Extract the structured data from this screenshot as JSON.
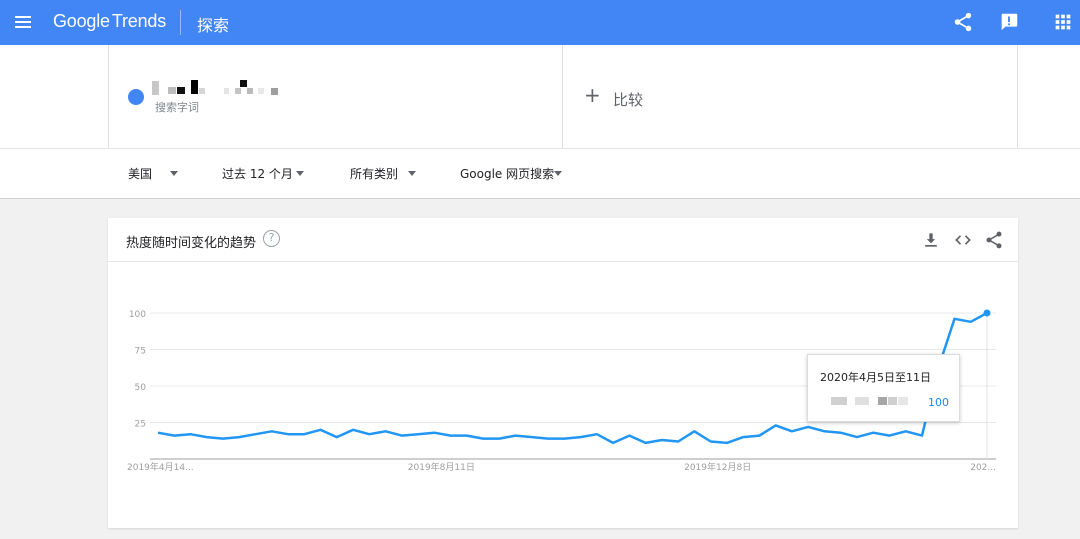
{
  "app": {
    "logo_google": "Google",
    "logo_trends": "Trends",
    "page_title": "探索"
  },
  "header_icons": [
    "share-icon",
    "feedback-icon",
    "apps-icon"
  ],
  "search": {
    "term_label": "搜索字词",
    "compare_label": "比较"
  },
  "filters": [
    {
      "label": "美国"
    },
    {
      "label": "过去 12 个月"
    },
    {
      "label": "所有类别"
    },
    {
      "label": "Google 网页搜索"
    }
  ],
  "card": {
    "title": "热度随时间变化的趋势",
    "help_glyph": "?"
  },
  "card_icons": [
    "download-icon",
    "embed-code-icon",
    "share-icon"
  ],
  "colors": {
    "header_blue": "#4285f4",
    "series_blue": "#2196f3",
    "tooltip_value": "#1e88e5"
  },
  "tooltip": {
    "date": "2020年4月5日至11日",
    "value": "100"
  },
  "chart_data": {
    "type": "line",
    "title": "",
    "ylim": [
      0,
      100
    ],
    "y_ticks": [
      25,
      50,
      75,
      100
    ],
    "x_tick_labels": [
      "2019年4月14...",
      "2019年8月11日",
      "2019年12月8日",
      "202..."
    ],
    "grid": true,
    "series": [
      {
        "values": [
          18,
          16,
          17,
          15,
          14,
          15,
          17,
          19,
          17,
          17,
          20,
          15,
          20,
          17,
          19,
          16,
          17,
          18,
          16,
          16,
          14,
          14,
          16,
          15,
          14,
          14,
          15,
          17,
          11,
          16,
          11,
          13,
          12,
          19,
          12,
          11,
          15,
          16,
          23,
          19,
          22,
          19,
          18,
          15,
          18,
          16,
          19,
          16,
          62,
          96,
          94,
          100
        ]
      }
    ]
  }
}
